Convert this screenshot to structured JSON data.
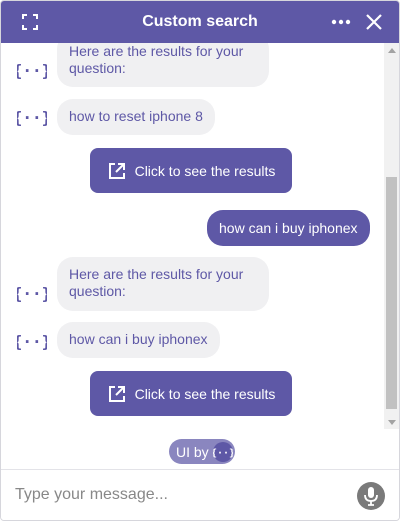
{
  "header": {
    "title": "Custom search",
    "expand_icon": "expand-icon",
    "more_icon": "more-dots-icon",
    "close_icon": "close-icon",
    "color": "#5e58a6"
  },
  "messages": [
    {
      "from": "bot",
      "text": "Here are the results for your question:"
    },
    {
      "from": "bot",
      "text": "how to reset iphone 8"
    },
    {
      "from": "bot_button",
      "label": "Click to see the results"
    },
    {
      "from": "user",
      "text": "how can i buy iphonex"
    },
    {
      "from": "bot",
      "text": "Here are the results for your question:"
    },
    {
      "from": "bot",
      "text": "how can i buy iphonex"
    },
    {
      "from": "bot_button",
      "label": "Click to see the results"
    }
  ],
  "branding": {
    "label": "UI by"
  },
  "composer": {
    "placeholder": "Type your message...",
    "mic_icon": "microphone-icon"
  }
}
